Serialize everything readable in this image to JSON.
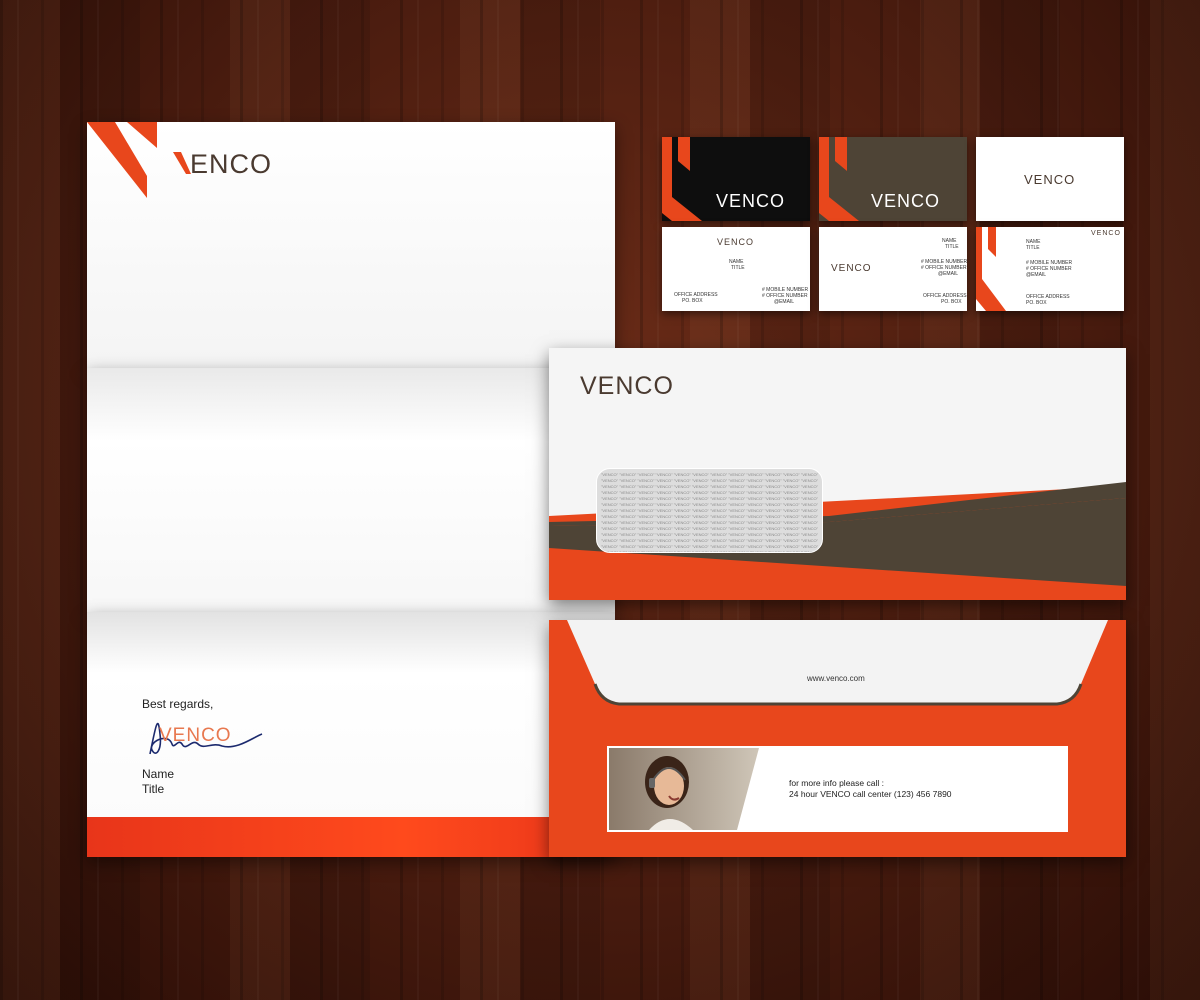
{
  "brand": {
    "name": "VENCO",
    "name_rest": "ENCO",
    "colors": {
      "orange": "#e8471c",
      "brown": "#4e4436",
      "black": "#0e0e0e",
      "white": "#ffffff"
    }
  },
  "letterhead": {
    "closing": "Best regards,",
    "signature_name": "Name",
    "signature_title": "Title"
  },
  "cards": {
    "name": "NAME",
    "title": "TITLE",
    "mobile": "# MOBILE NUMBER",
    "office": "# OFFICE NUMBER",
    "email": "@EMAIL",
    "address": "OFFICE ADDRESS",
    "pobox": "PO. BOX"
  },
  "envelope_front": {
    "window_pattern_word": "VENCO"
  },
  "envelope_back": {
    "website": "www.venco.com",
    "info_line1": "for more info please call :",
    "info_line2": "24 hour VENCO call center (123) 456 7890",
    "photo_icon": "call-center-agent-photo"
  }
}
